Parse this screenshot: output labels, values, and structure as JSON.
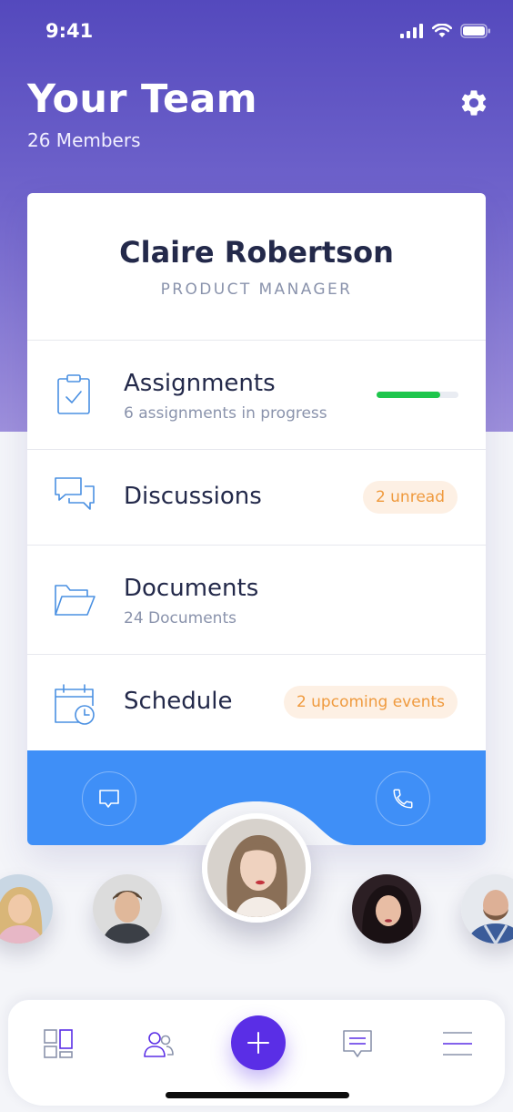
{
  "status_bar": {
    "time": "9:41"
  },
  "header": {
    "title": "Your Team",
    "subtitle": "26 Members",
    "settings_icon": "gear-icon"
  },
  "profile": {
    "name": "Claire Robertson",
    "role": "PRODUCT MANAGER"
  },
  "menu": {
    "assignments": {
      "label": "Assignments",
      "sub": "6 assignments in progress",
      "progress": 0.78,
      "icon": "clipboard-icon"
    },
    "discussions": {
      "label": "Discussions",
      "badge": "2 unread",
      "icon": "chat-bubbles-icon"
    },
    "documents": {
      "label": "Documents",
      "sub": "24 Documents",
      "icon": "folder-icon"
    },
    "schedule": {
      "label": "Schedule",
      "badge": "2 upcoming events",
      "icon": "calendar-clock-icon"
    }
  },
  "actions": {
    "message_icon": "message-icon",
    "call_icon": "phone-icon"
  },
  "team_avatars": [
    "blonde-woman-avatar",
    "man-avatar",
    "claire-avatar-selected",
    "dark-haired-woman-avatar",
    "bearded-man-avatar"
  ],
  "tabbar": {
    "items": [
      "dashboard-icon",
      "team-icon",
      "add-icon",
      "messages-icon",
      "menu-icon"
    ]
  },
  "colors": {
    "accent": "#5a2ee6",
    "blue": "#3f8ff7",
    "green": "#1ec64c",
    "badge_text": "#ef9a3e",
    "header_top": "#5449bd"
  }
}
